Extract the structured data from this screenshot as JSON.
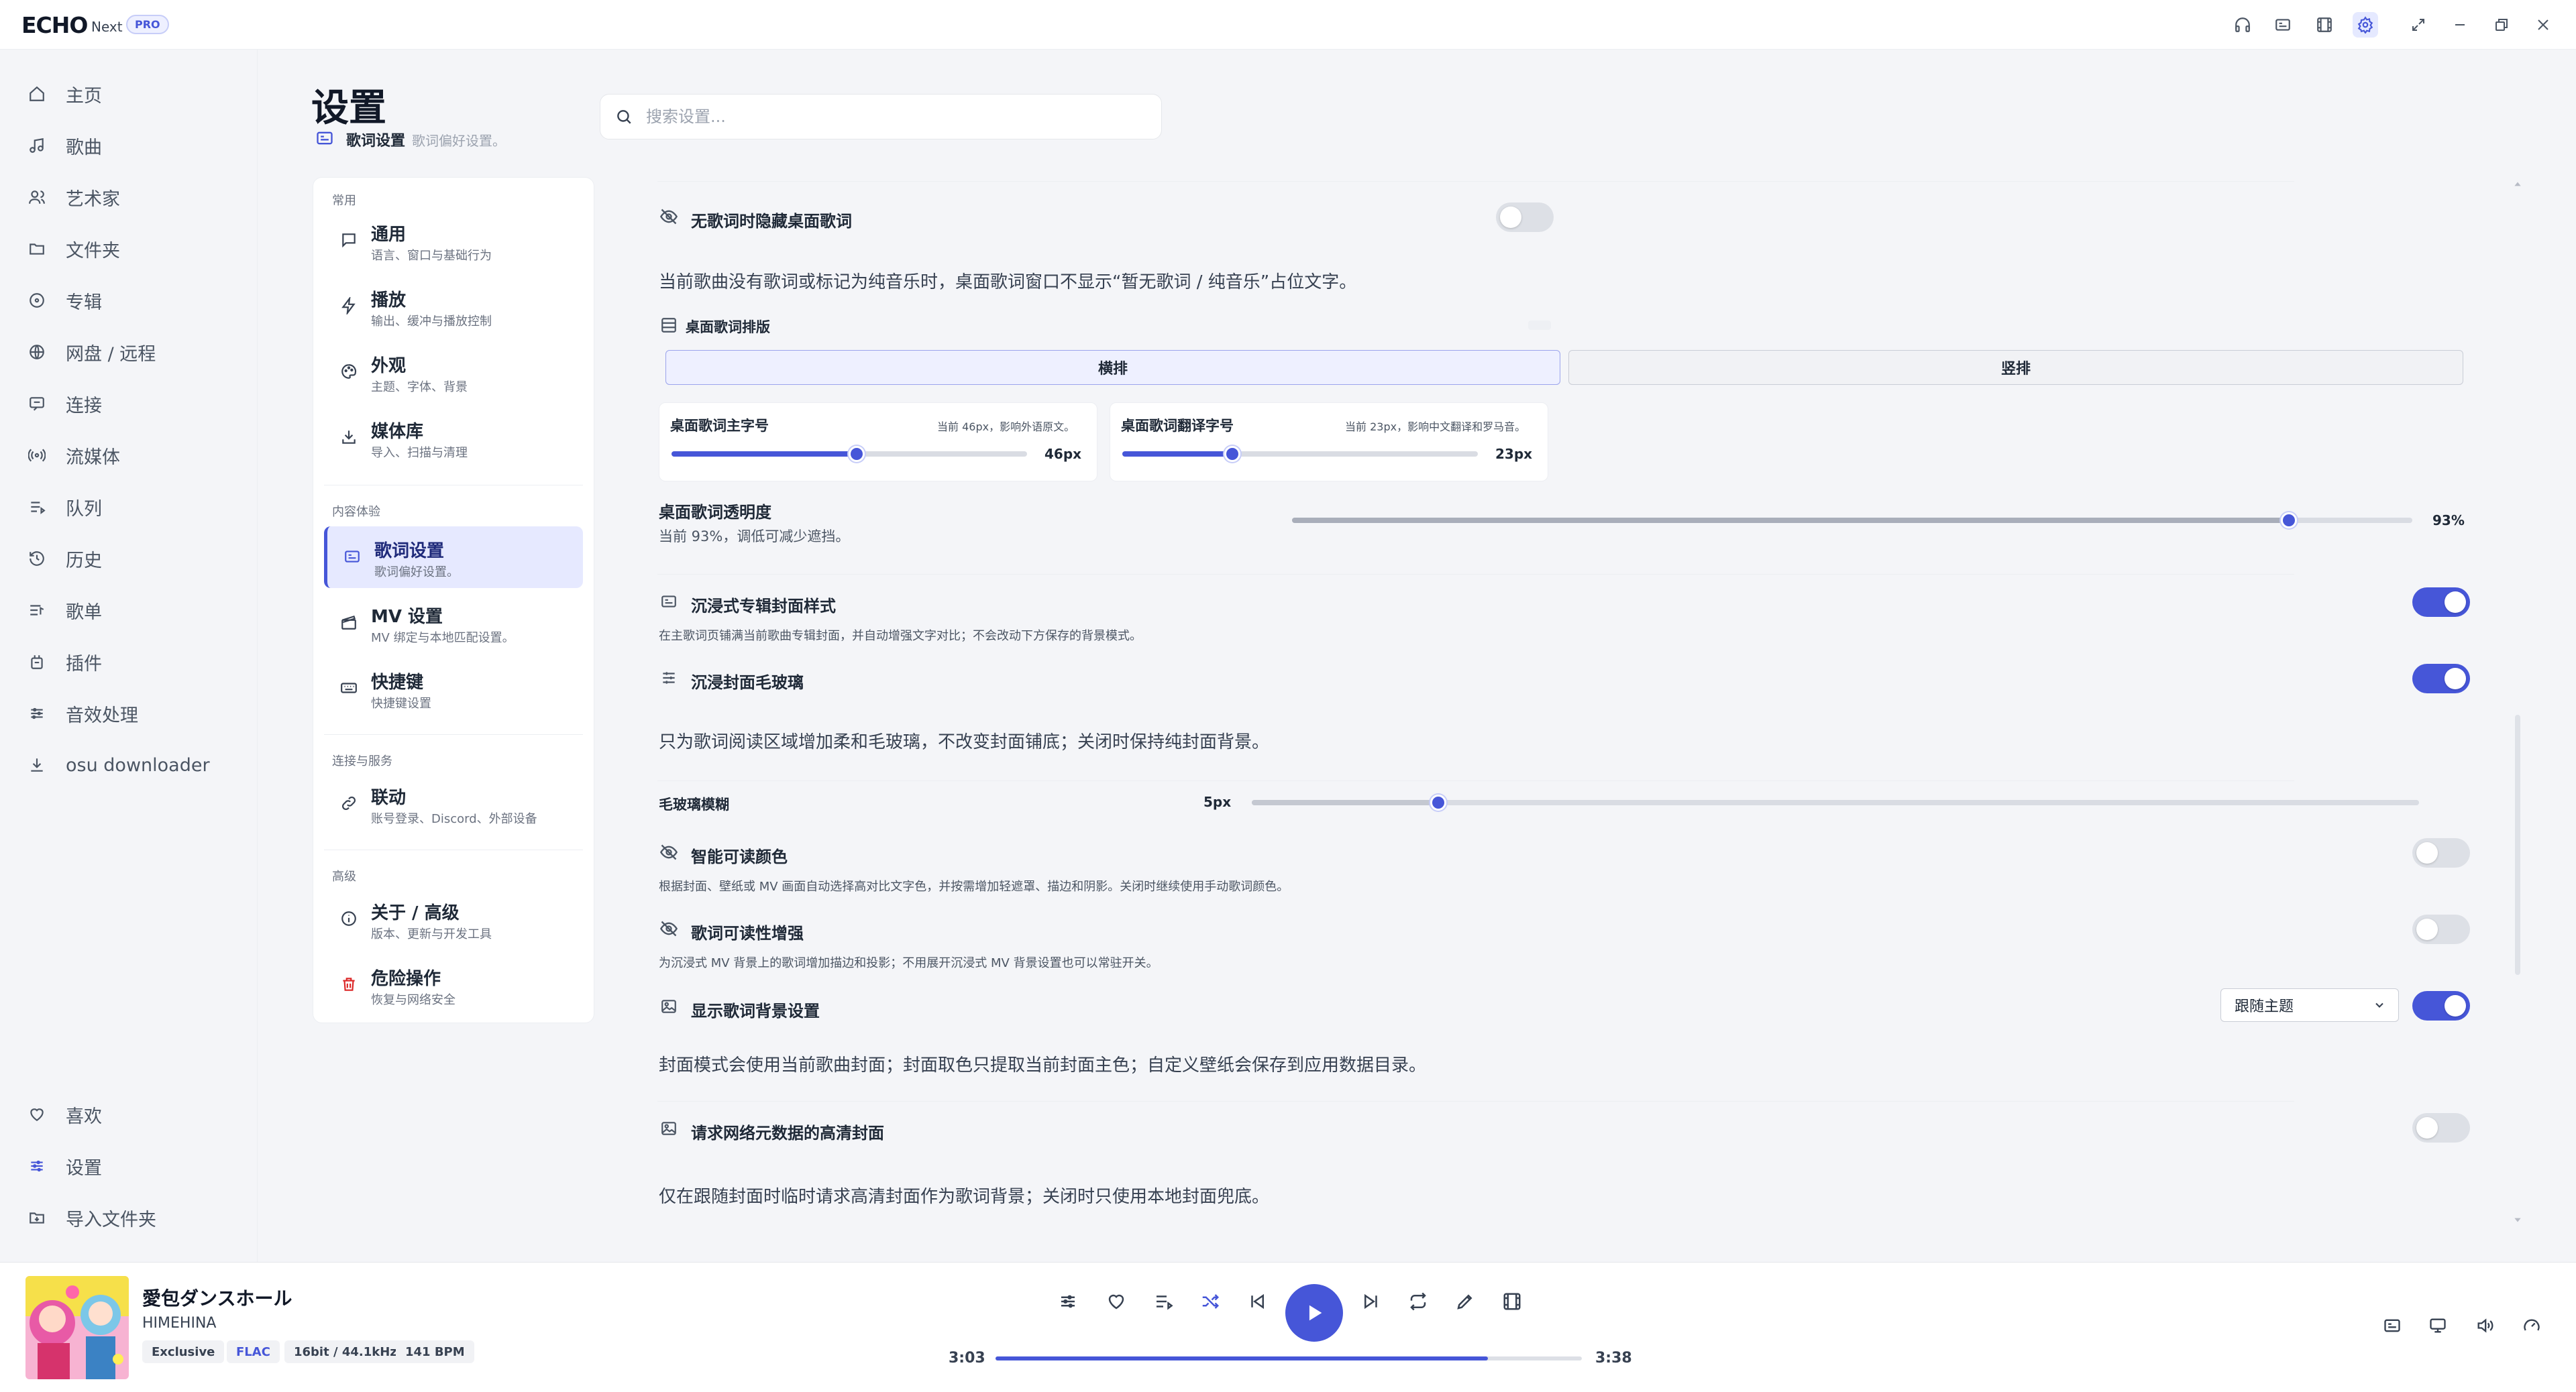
{
  "app": {
    "brand": "ECHO",
    "edition": "Next",
    "tier": "PRO"
  },
  "sidebar": {
    "items": [
      {
        "label": "主页",
        "icon": "home-icon"
      },
      {
        "label": "歌曲",
        "icon": "music-note-icon"
      },
      {
        "label": "艺术家",
        "icon": "users-icon"
      },
      {
        "label": "文件夹",
        "icon": "folder-icon"
      },
      {
        "label": "专辑",
        "icon": "disc-icon"
      },
      {
        "label": "网盘 / 远程",
        "icon": "globe-icon"
      },
      {
        "label": "连接",
        "icon": "chat-icon"
      },
      {
        "label": "流媒体",
        "icon": "broadcast-icon"
      },
      {
        "label": "队列",
        "icon": "queue-icon"
      },
      {
        "label": "历史",
        "icon": "history-icon"
      },
      {
        "label": "歌单",
        "icon": "playlist-icon"
      },
      {
        "label": "插件",
        "icon": "plugin-icon"
      },
      {
        "label": "音效处理",
        "icon": "equalizer-icon"
      },
      {
        "label": "osu downloader",
        "icon": "download-icon"
      }
    ],
    "bottom": [
      {
        "label": "喜欢",
        "icon": "heart-icon"
      },
      {
        "label": "设置",
        "icon": "settings-sliders-icon"
      },
      {
        "label": "导入文件夹",
        "icon": "folder-import-icon"
      }
    ]
  },
  "header": {
    "title": "设置",
    "subtitle": "歌词设置",
    "subtitle_desc": "歌词偏好设置。",
    "search_placeholder": "搜索设置..."
  },
  "menu": {
    "groups": {
      "common": "常用",
      "content": "内容体验",
      "connect": "连接与服务",
      "advanced": "高级"
    },
    "items": [
      {
        "title": "通用",
        "desc": "语言、窗口与基础行为"
      },
      {
        "title": "播放",
        "desc": "输出、缓冲与播放控制"
      },
      {
        "title": "外观",
        "desc": "主题、字体、背景"
      },
      {
        "title": "媒体库",
        "desc": "导入、扫描与清理"
      },
      {
        "title": "歌词设置",
        "desc": "歌词偏好设置。"
      },
      {
        "title": "MV 设置",
        "desc": "MV 绑定与本地匹配设置。"
      },
      {
        "title": "快捷键",
        "desc": "快捷键设置"
      },
      {
        "title": "联动",
        "desc": "账号登录、Discord、外部设备"
      },
      {
        "title": "关于 / 高级",
        "desc": "版本、更新与开发工具"
      },
      {
        "title": "危险操作",
        "desc": "恢复与网络安全"
      }
    ]
  },
  "content": {
    "hide_desktop": {
      "title": "无歌词时隐藏桌面歌词",
      "enabled": false,
      "desc": "当前歌曲没有歌词或标记为纯音乐时，桌面歌词窗口不显示“暂无歌词 / 纯音乐”占位文字。"
    },
    "layout": {
      "title": "桌面歌词排版",
      "options": [
        "横排",
        "竖排"
      ],
      "selected": "横排"
    },
    "main_size": {
      "title": "桌面歌词主字号",
      "hint": "当前 46px，影响外语原文。",
      "value_label": "46px",
      "fraction": 0.52
    },
    "trans_size": {
      "title": "桌面歌词翻译字号",
      "hint": "当前 23px，影响中文翻译和罗马音。",
      "value_label": "23px",
      "fraction": 0.31
    },
    "opacity": {
      "title": "桌面歌词透明度",
      "desc": "当前 93%，调低可减少遮挡。",
      "value_label": "93%",
      "fraction": 0.89
    },
    "immersive_cover": {
      "title": "沉浸式专辑封面样式",
      "enabled": true,
      "desc": "在主歌词页铺满当前歌曲专辑封面，并自动增强文字对比；不会改动下方保存的背景模式。"
    },
    "frosted": {
      "title": "沉浸封面毛玻璃",
      "enabled": true,
      "desc": "只为歌词阅读区域增加柔和毛玻璃，不改变封面铺底；关闭时保持纯封面背景。"
    },
    "blur": {
      "title": "毛玻璃模糊",
      "value_label": "5px",
      "fraction": 0.16
    },
    "smart_color": {
      "title": "智能可读颜色",
      "enabled": false,
      "desc": "根据封面、壁纸或 MV 画面自动选择高对比文字色，并按需增加轻遮罩、描边和阴影。关闭时继续使用手动歌词颜色。"
    },
    "readability": {
      "title": "歌词可读性增强",
      "enabled": false,
      "desc": "为沉浸式 MV 背景上的歌词增加描边和投影；不用展开沉浸式 MV 背景设置也可以常驻开关。"
    },
    "background": {
      "title": "显示歌词背景设置",
      "enabled": true,
      "select_value": "跟随主题",
      "desc": "封面模式会使用当前歌曲封面；封面取色只提取当前封面主色；自定义壁纸会保存到应用数据目录。"
    },
    "hd_cover": {
      "title": "请求网络元数据的高清封面",
      "enabled": false,
      "desc": "仅在跟随封面时临时请求高清封面作为歌词背景；关闭时只使用本地封面兜底。"
    }
  },
  "player": {
    "title": "愛包ダンスホール",
    "artist": "HIMEHINA",
    "badges": [
      "Exclusive",
      "FLAC",
      "16bit / 44.1kHz",
      "141 BPM"
    ],
    "elapsed": "3:03",
    "duration": "3:38",
    "progress": 0.84
  },
  "colors": {
    "accent": "#4656d8",
    "danger": "#dc2626"
  }
}
